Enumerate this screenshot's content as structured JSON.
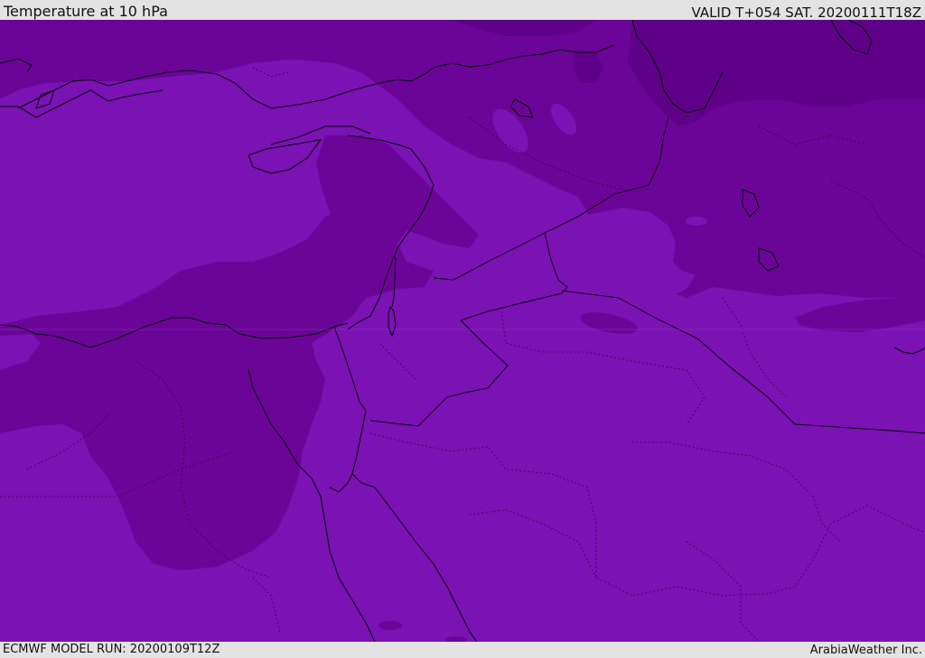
{
  "header": {
    "title": "Temperature at 10 hPa",
    "valid": "VALID T+054 SAT. 20200111T18Z"
  },
  "footer": {
    "model_run": "ECMWF MODEL RUN: 20200109T12Z",
    "credit": "ArabiaWeather Inc."
  },
  "map": {
    "region": "Eastern Mediterranean and Middle East",
    "colors": {
      "warm_band": "#7a12b4",
      "cool_band": "#6a0598",
      "coldest_band": "#5e0188",
      "coastline": "#000000",
      "borders": "#000000"
    }
  }
}
